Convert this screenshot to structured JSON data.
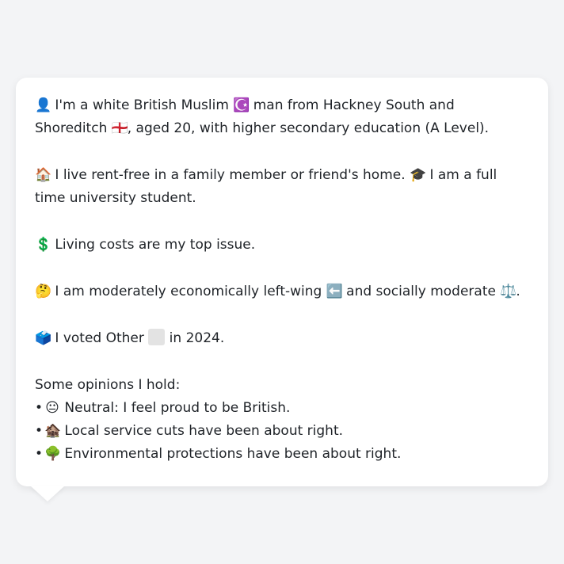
{
  "profile": {
    "line1": {
      "person_emoji": "👤",
      "text_a": " I'm a white British Muslim ",
      "religion_emoji": "☪️",
      "text_b": " man from Hackney South and Shoreditch ",
      "flag_emoji": "🏴󠁧󠁢󠁥󠁮󠁧󠁿",
      "text_c": ", aged 20, with higher secondary education (A Level)."
    },
    "line2": {
      "house_emoji": "🏠",
      "text_a": " I live rent-free in a family member or friend's home. ",
      "grad_emoji": "🎓",
      "text_b": " I am a full time university student."
    },
    "line3": {
      "money_emoji": "💲",
      "text": " Living costs are my top issue."
    },
    "line4": {
      "think_emoji": "🤔",
      "text_a": " I am moderately economically left-wing ",
      "left_emoji": "⬅️",
      "text_b": " and socially moderate ",
      "scale_emoji": "⚖️",
      "text_c": "."
    },
    "line5": {
      "ballot_emoji": "🗳️",
      "text_a": " I voted Other ",
      "text_b": " in 2024."
    },
    "opinions_heading": "Some opinions I hold:",
    "opinions": [
      {
        "bullet": "•",
        "emoji": "😐",
        "text": " Neutral: I feel proud to be British."
      },
      {
        "bullet": "•",
        "emoji": "🏚️",
        "text": " Local service cuts have been about right."
      },
      {
        "bullet": "•",
        "emoji": "🌳",
        "text": " Environmental protections have been about right."
      }
    ]
  },
  "colors": {
    "background": "#f3f4f6",
    "card": "#ffffff",
    "text": "#1f2328",
    "other_party_swatch": "#e3e3e3"
  }
}
